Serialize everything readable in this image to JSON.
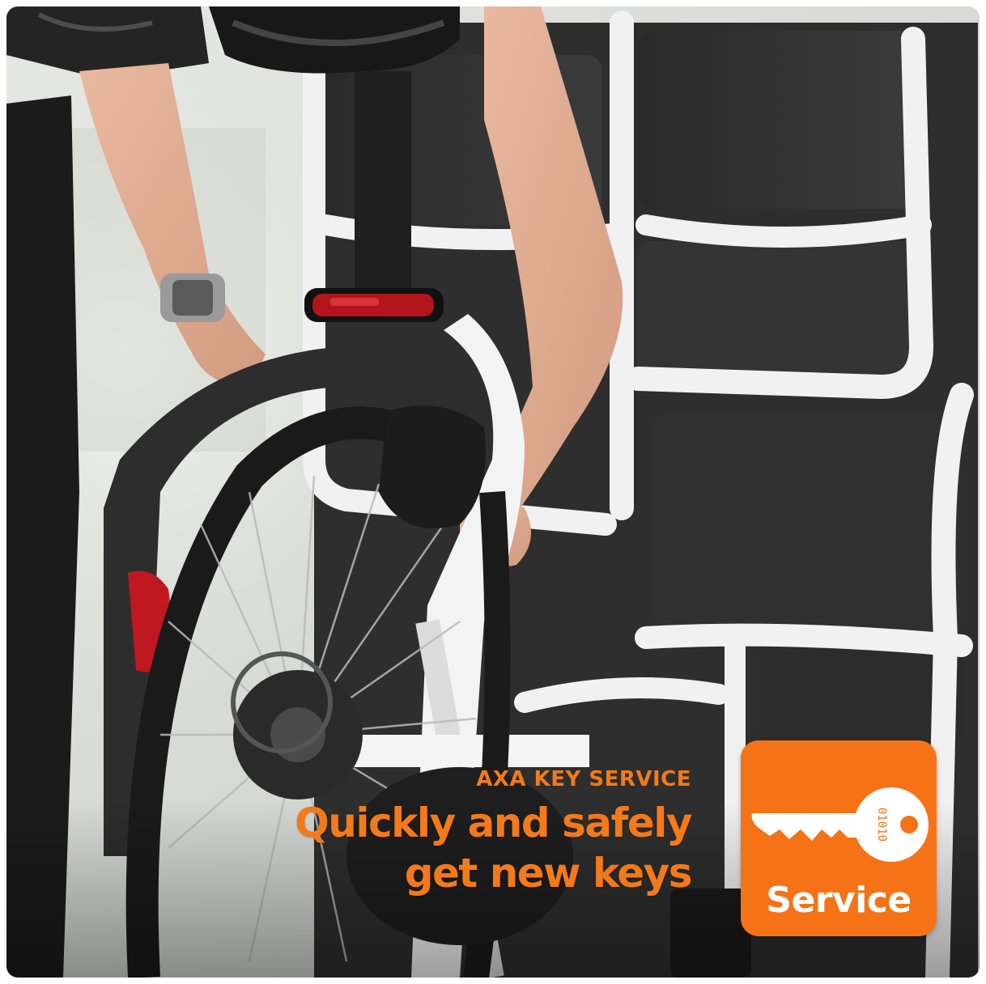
{
  "promo": {
    "kicker": "AXA KEY SERVICE",
    "headline_line1": "Quickly and safely",
    "headline_line2": "get new keys"
  },
  "badge": {
    "label": "Service",
    "key_code": "01010",
    "icon": "key-icon"
  },
  "colors": {
    "accent": "#f27a1a",
    "badge": "#f57316",
    "text_on_badge": "#ffffff"
  }
}
